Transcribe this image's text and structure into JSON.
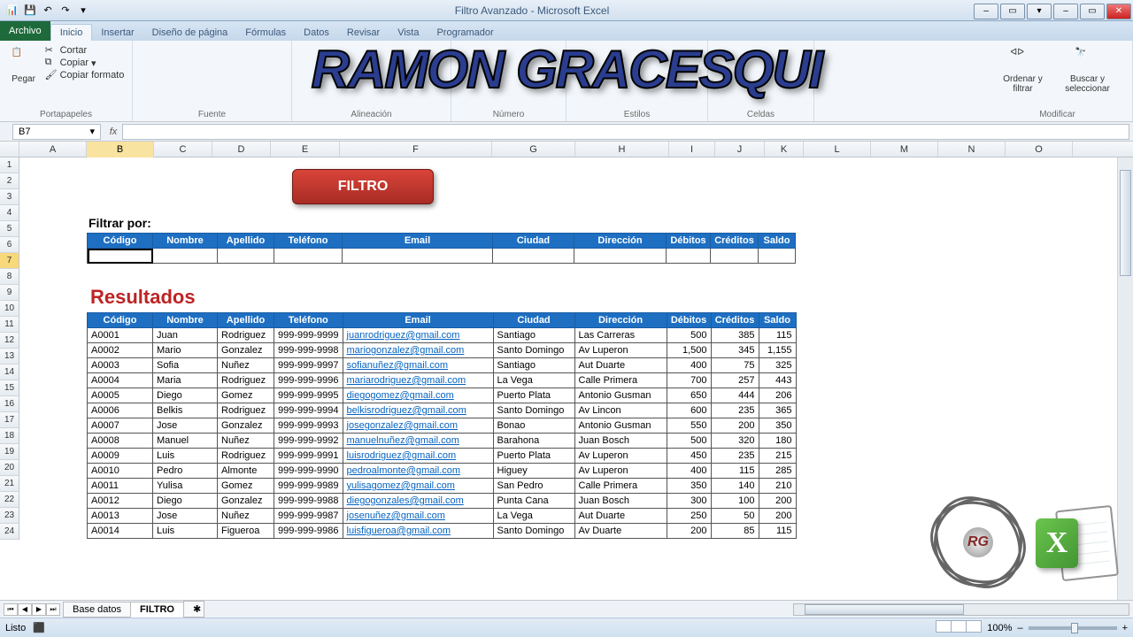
{
  "window": {
    "title": "Filtro Avanzado - Microsoft Excel",
    "min": "–",
    "max": "▭",
    "close": "✕"
  },
  "file_tab": "Archivo",
  "tabs": [
    "Inicio",
    "Insertar",
    "Diseño de página",
    "Fórmulas",
    "Datos",
    "Revisar",
    "Vista",
    "Programador"
  ],
  "active_tab": "Inicio",
  "ribbon": {
    "portapapeles": {
      "label": "Portapapeles",
      "pegar": "Pegar",
      "cortar": "Cortar",
      "copiar": "Copiar",
      "copiar_formato": "Copiar formato"
    },
    "fuente": {
      "label": "Fuente"
    },
    "alineacion": {
      "label": "Alineación"
    },
    "numero": {
      "label": "Número"
    },
    "estilos": {
      "label": "Estilos"
    },
    "celdas": {
      "label": "Celdas"
    },
    "modificar": {
      "label": "Modificar",
      "ordenar": "Ordenar y filtrar",
      "buscar": "Buscar y seleccionar"
    }
  },
  "namebox": "B7",
  "watermark": "RAMON GRACESQUI",
  "columns": [
    "A",
    "B",
    "C",
    "D",
    "E",
    "F",
    "G",
    "H",
    "I",
    "J",
    "K",
    "L",
    "M",
    "N",
    "O"
  ],
  "rows": [
    "1",
    "2",
    "3",
    "4",
    "5",
    "6",
    "7",
    "8",
    "9",
    "10",
    "11",
    "12",
    "13",
    "14",
    "15",
    "16",
    "17",
    "18",
    "19",
    "20",
    "21",
    "22",
    "23",
    "24"
  ],
  "selected_row": "7",
  "filtro_button": "FILTRO",
  "filtrar_por": "Filtrar por:",
  "resultados": "Resultados",
  "headers": [
    "Código",
    "Nombre",
    "Apellido",
    "Teléfono",
    "Email",
    "Ciudad",
    "Dirección",
    "Débitos",
    "Créditos",
    "Saldo"
  ],
  "data": [
    [
      "A0001",
      "Juan",
      "Rodriguez",
      "999-999-9999",
      "juanrodriguez@gmail.com",
      "Santiago",
      "Las Carreras",
      "500",
      "385",
      "115"
    ],
    [
      "A0002",
      "Mario",
      "Gonzalez",
      "999-999-9998",
      "mariogonzalez@gmail.com",
      "Santo Domingo",
      "Av Luperon",
      "1,500",
      "345",
      "1,155"
    ],
    [
      "A0003",
      "Sofia",
      "Nuñez",
      "999-999-9997",
      "sofianuñez@gmail.com",
      "Santiago",
      "Aut Duarte",
      "400",
      "75",
      "325"
    ],
    [
      "A0004",
      "Maria",
      "Rodriguez",
      "999-999-9996",
      "mariarodriguez@gmail.com",
      "La Vega",
      "Calle Primera",
      "700",
      "257",
      "443"
    ],
    [
      "A0005",
      "Diego",
      "Gomez",
      "999-999-9995",
      "diegogomez@gmail.com",
      "Puerto Plata",
      "Antonio Gusman",
      "650",
      "444",
      "206"
    ],
    [
      "A0006",
      "Belkis",
      "Rodriguez",
      "999-999-9994",
      "belkisrodriguez@gmail.com",
      "Santo Domingo",
      "Av Lincon",
      "600",
      "235",
      "365"
    ],
    [
      "A0007",
      "Jose",
      "Gonzalez",
      "999-999-9993",
      "josegonzalez@gmail.com",
      "Bonao",
      "Antonio Gusman",
      "550",
      "200",
      "350"
    ],
    [
      "A0008",
      "Manuel",
      "Nuñez",
      "999-999-9992",
      "manuelnuñez@gmail.com",
      "Barahona",
      "Juan Bosch",
      "500",
      "320",
      "180"
    ],
    [
      "A0009",
      "Luis",
      "Rodriguez",
      "999-999-9991",
      "luisrodriguez@gmail.com",
      "Puerto Plata",
      "Av Luperon",
      "450",
      "235",
      "215"
    ],
    [
      "A0010",
      "Pedro",
      "Almonte",
      "999-999-9990",
      "pedroalmonte@gmail.com",
      "Higuey",
      "Av Luperon",
      "400",
      "115",
      "285"
    ],
    [
      "A0011",
      "Yulisa",
      "Gomez",
      "999-999-9989",
      "yulisagomez@gmail.com",
      "San Pedro",
      "Calle Primera",
      "350",
      "140",
      "210"
    ],
    [
      "A0012",
      "Diego",
      "Gonzalez",
      "999-999-9988",
      "diegogonzales@gmail.com",
      "Punta Cana",
      "Juan Bosch",
      "300",
      "100",
      "200"
    ],
    [
      "A0013",
      "Jose",
      "Nuñez",
      "999-999-9987",
      "josenuñez@gmail.com",
      "La Vega",
      "Aut Duarte",
      "250",
      "50",
      "200"
    ],
    [
      "A0014",
      "Luis",
      "Figueroa",
      "999-999-9986",
      "luisfigueroa@gmail.com",
      "Santo Domingo",
      "Av Duarte",
      "200",
      "85",
      "115"
    ]
  ],
  "sheets": {
    "tab1": "Base datos",
    "tab2": "FILTRO"
  },
  "status": {
    "ready": "Listo",
    "zoom": "100%",
    "minus": "–",
    "plus": "+"
  },
  "atom_initials": "RG"
}
